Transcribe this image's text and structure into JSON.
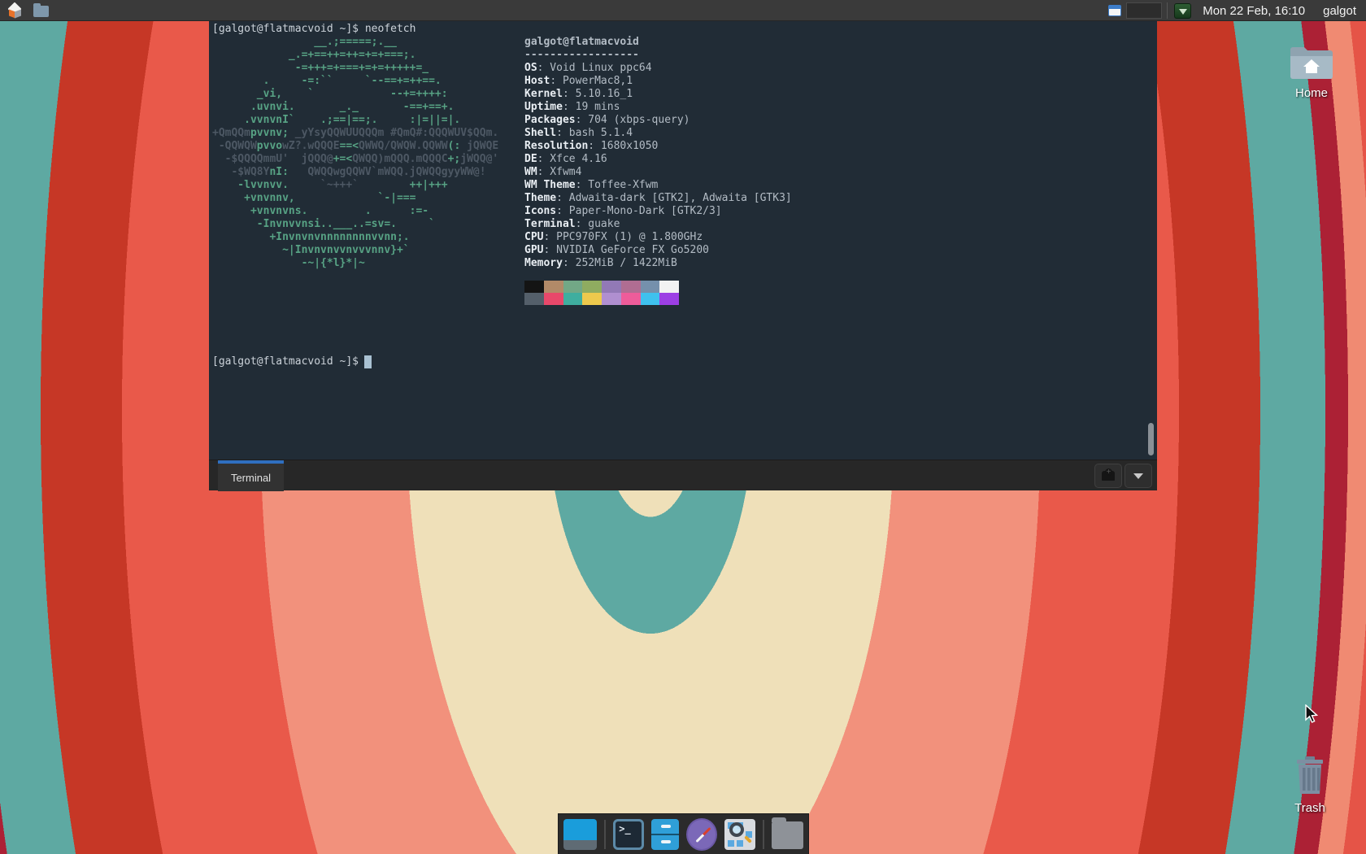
{
  "panel": {
    "clock": "Mon 22 Feb, 16:10",
    "user": "galgot",
    "icons": [
      "applications-menu-icon",
      "file-manager-icon",
      "window-buttons-icon",
      "workspace-pager",
      "guake-tray-icon"
    ]
  },
  "terminal": {
    "prompt1": "[galgot@flatmacvoid ~]$ neofetch",
    "prompt2": "[galgot@flatmacvoid ~]$ ",
    "tab_label": "Terminal",
    "colors": {
      "background": "#212c36",
      "ascii_green": "#57a284",
      "ascii_dark": "#4d5864",
      "cursor": "#a9c1d2",
      "tab_accent": "#2f6fc0"
    },
    "ascii_lines": [
      [
        [
          "g",
          "                __.;=====;.__"
        ]
      ],
      [
        [
          "g",
          "            _.=+==++=++=+=+===;."
        ]
      ],
      [
        [
          "g",
          "             -=+++=+===+=+=+++++=_"
        ]
      ],
      [
        [
          "g",
          "        .     -=:``     `--==+=++==."
        ]
      ],
      [
        [
          "g",
          "       _vi,    `            --+=++++:"
        ]
      ],
      [
        [
          "g",
          "      .uvnvi.       _._       -==+==+."
        ]
      ],
      [
        [
          "g",
          "     .vvnvnI`    .;==|==;.     :|=||=|."
        ]
      ],
      [
        [
          "d",
          "+QmQQm"
        ],
        [
          "g",
          "pvvnv;"
        ],
        [
          "d",
          " _yYsyQQWUUQQQm #QmQ#:QQQWUV$QQm."
        ]
      ],
      [
        [
          "d",
          " -QQWQW"
        ],
        [
          "g",
          "pvvo"
        ],
        [
          "d",
          "wZ?.wQQQE"
        ],
        [
          "g",
          "==<"
        ],
        [
          "d",
          "QWWQ/QWQW.QQWW"
        ],
        [
          "g",
          "(:"
        ],
        [
          "d",
          " jQWQE"
        ]
      ],
      [
        [
          "d",
          "  -$QQQQmmU'  jQQQ@"
        ],
        [
          "g",
          "+=<"
        ],
        [
          "d",
          "QWQQ)mQQQ.mQQQC"
        ],
        [
          "g",
          "+;"
        ],
        [
          "d",
          "jWQQ@'"
        ]
      ],
      [
        [
          "d",
          "   -$WQ8Y"
        ],
        [
          "g",
          "nI:"
        ],
        [
          "d",
          "   QWQQwgQQWV`mWQQ.jQWQQgyyWW@!"
        ]
      ],
      [
        [
          "g",
          "    -lvvnvv."
        ],
        [
          "d",
          "     `~+++`"
        ],
        [
          "g",
          "        ++|+++"
        ]
      ],
      [
        [
          "g",
          "     +vnvnnv,             `-|==="
        ]
      ],
      [
        [
          "g",
          "      +vnvnvns.         .      :=-"
        ]
      ],
      [
        [
          "g",
          "       -Invnvvnsi..___..=sv=.     `"
        ]
      ],
      [
        [
          "g",
          "         +Invnvnvnnnnnnnnvvnn;."
        ]
      ],
      [
        [
          "g",
          "           ~|Invnvnvvnvvvnnv}+`"
        ]
      ],
      [
        [
          "g",
          "              -~|{*l}*|~"
        ]
      ]
    ],
    "neofetch": {
      "header": "galgot@flatmacvoid",
      "separator": "------------------",
      "fields": [
        {
          "label": "OS",
          "value": "Void Linux ppc64"
        },
        {
          "label": "Host",
          "value": "PowerMac8,1"
        },
        {
          "label": "Kernel",
          "value": "5.10.16_1"
        },
        {
          "label": "Uptime",
          "value": "19 mins"
        },
        {
          "label": "Packages",
          "value": "704 (xbps-query)"
        },
        {
          "label": "Shell",
          "value": "bash 5.1.4"
        },
        {
          "label": "Resolution",
          "value": "1680x1050"
        },
        {
          "label": "DE",
          "value": "Xfce 4.16"
        },
        {
          "label": "WM",
          "value": "Xfwm4"
        },
        {
          "label": "WM Theme",
          "value": "Toffee-Xfwm"
        },
        {
          "label": "Theme",
          "value": "Adwaita-dark [GTK2], Adwaita [GTK3]"
        },
        {
          "label": "Icons",
          "value": "Paper-Mono-Dark [GTK2/3]"
        },
        {
          "label": "Terminal",
          "value": "guake"
        },
        {
          "label": "CPU",
          "value": "PPC970FX (1) @ 1.800GHz"
        },
        {
          "label": "GPU",
          "value": "NVIDIA GeForce FX Go5200"
        },
        {
          "label": "Memory",
          "value": "252MiB / 1422MiB"
        }
      ],
      "palette_row1": [
        "#141414",
        "#b28a68",
        "#72a886",
        "#8fac60",
        "#9279b6",
        "#b06d92",
        "#7590ac",
        "#f2f2f2"
      ],
      "palette_row2": [
        "#545f6a",
        "#e8486a",
        "#3fae9f",
        "#edc94d",
        "#b08fd0",
        "#ee5c9a",
        "#3fc1ee",
        "#9c3fe4"
      ]
    }
  },
  "desktop": {
    "home_label": "Home",
    "trash_label": "Trash",
    "wallpaper_ring_colors": [
      "#efe0b9",
      "#5ea9a2",
      "#f2917c",
      "#e9594a",
      "#c63726",
      "#ac2135",
      "#f08a72",
      "#e55447",
      "#ef7d62",
      "#c42a20",
      "#ead9a8"
    ]
  },
  "dock": {
    "icons": [
      "show-desktop-icon",
      "terminal-icon",
      "file-cabinet-icon",
      "web-browser-compass-icon",
      "app-finder-icon",
      "folder-icon"
    ],
    "terminal_glyph": ">_"
  }
}
